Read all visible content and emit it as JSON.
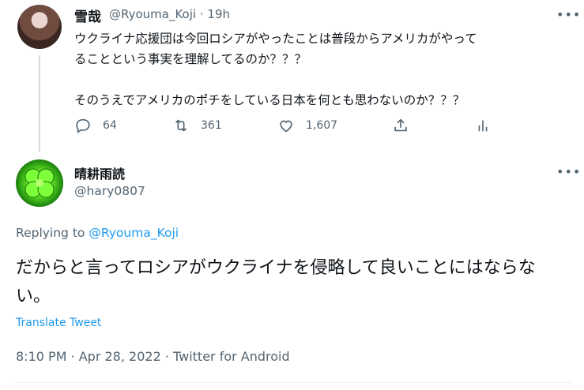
{
  "parent_tweet": {
    "display_name": "雪哉",
    "handle": "@Ryouma_Koji",
    "separator": "·",
    "time_ago": "19h",
    "more_label": "•••",
    "text_line1": "ウクライナ応援団は今回ロシアがやったことは普段からアメリカがやって",
    "text_line2": "ることという事実を理解してるのか？？？",
    "text_line3": "そのうえでアメリカのポチをしている日本を何とも思わないのか？？？",
    "reply_count": "64",
    "retweet_count": "361",
    "like_count": "1,607"
  },
  "reply_tweet": {
    "display_name": "晴耕雨読",
    "handle": "@hary0807",
    "more_label": "•••",
    "replying_prefix": "Replying to",
    "replying_handle": "@Ryouma_Koji",
    "text": "だからと言ってロシアがウクライナを侵略して良いことにはならない。",
    "translate_label": "Translate Tweet",
    "timestamp": "8:10 PM · Apr 28, 2022 · Twitter for Android"
  },
  "icons": [
    "reply-icon",
    "retweet-icon",
    "like-icon",
    "share-icon",
    "analytics-icon"
  ],
  "colors": {
    "text": "#0f1419",
    "muted": "#536471",
    "link": "#1d9bf0",
    "thread_line": "#cfd9de"
  }
}
